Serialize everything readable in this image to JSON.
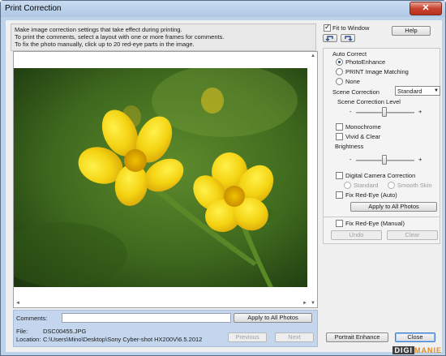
{
  "window": {
    "title": "Print Correction",
    "close_glyph": "✕"
  },
  "instructions": [
    "Make image correction settings that take effect during printing.",
    "To print the comments, select a layout with one or more frames for comments.",
    "To fix the photo manually, click up to 20 red-eye parts in the image."
  ],
  "scrollbar": {
    "up": "▲",
    "down": "▼",
    "left": "◄",
    "right": "►"
  },
  "bottom_bar": {
    "comments_label": "Comments:",
    "comments_value": "",
    "apply_all_photos_label": "Apply to All Photos",
    "file_label": "File:",
    "file_value": "DSC00455.JPG",
    "location_label": "Location:",
    "location_value": "C:\\Users\\Mino\\Desktop\\Sony Cyber-shot HX200V\\6.5.2012",
    "previous_label": "Previous",
    "next_label": "Next"
  },
  "controls": {
    "fit_to_window_label": "Fit to Window",
    "fit_to_window_checked": true,
    "help_label": "Help",
    "rotate_left_icon": "rotate-left-icon",
    "rotate_right_icon": "rotate-right-icon",
    "auto_correct_label": "Auto Correct",
    "auto_correct_options": [
      "PhotoEnhance",
      "PRINT Image Matching",
      "None"
    ],
    "auto_correct_selected": "PhotoEnhance",
    "scene_correction_label": "Scene Correction",
    "scene_correction_value": "Standard",
    "scene_correction_level_label": "Scene Correction Level",
    "minus": "-",
    "plus": "+",
    "monochrome_label": "Monochrome",
    "vivid_clear_label": "Vivid & Clear",
    "brightness_label": "Brightness",
    "digital_camera_correction_label": "Digital Camera Correction",
    "standard_label": "Standard",
    "smooth_skin_label": "Smooth Skin",
    "fix_red_eye_auto_label": "Fix Red-Eye (Auto)",
    "apply_to_all_photos_label": "Apply to All Photos",
    "fix_red_eye_manual_label": "Fix Red-Eye (Manual)",
    "undo_label": "Undo",
    "clear_label": "Clear",
    "portrait_enhance_label": "Portrait Enhance",
    "close_label": "Close"
  },
  "watermark": {
    "part1": "DIGI",
    "part2": "MANIE"
  },
  "colors": {
    "accent": "#3a7bd5",
    "close_red": "#c8432e",
    "watermark_orange": "#e08a1e"
  }
}
